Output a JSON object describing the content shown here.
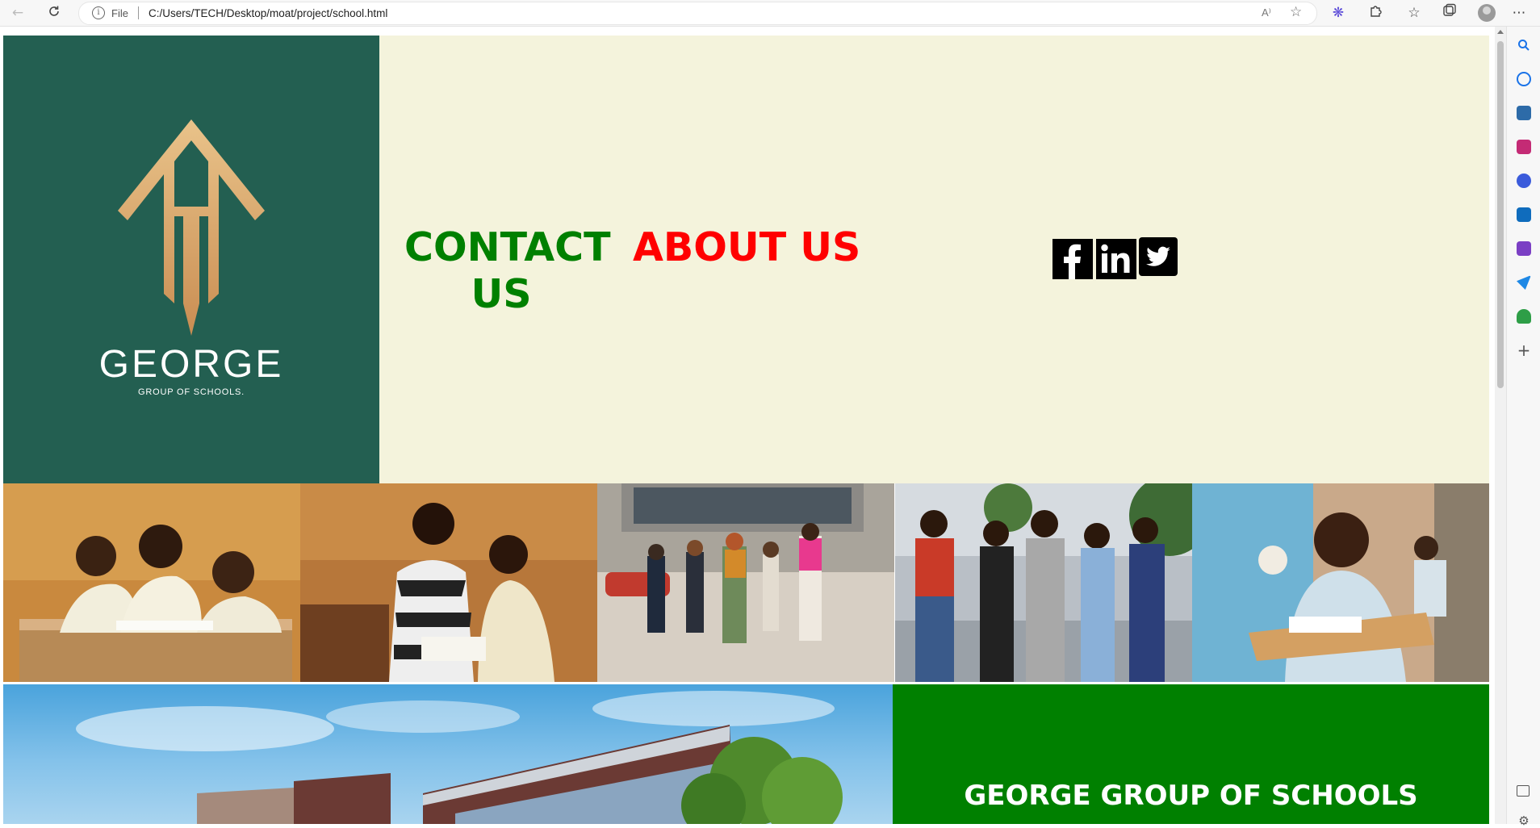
{
  "browser": {
    "file_label": "File",
    "url": "C:/Users/TECH/Desktop/moat/project/school.html",
    "read_aloud_label": "A⁾"
  },
  "hero": {
    "logo_name": "GEORGE",
    "logo_tagline": "GROUP OF SCHOOLS.",
    "contact_label": "CONTACT US",
    "about_label": "ABOUT US",
    "social_icons": [
      "facebook-icon",
      "linkedin-icon",
      "twitter-icon"
    ]
  },
  "gallery": {
    "photos": [
      "students-reading-photo",
      "teacher-and-pupil-photo",
      "students-walking-to-school-photo",
      "university-students-photo",
      "smiling-schoolboy-photo"
    ]
  },
  "banner": {
    "title": "GEORGE GROUP OF SCHOOLS"
  },
  "colors": {
    "logo_panel": "#235f51",
    "hero_background": "#f4f3dc",
    "contact": "#008000",
    "about": "#ff0000",
    "banner": "#008000"
  }
}
